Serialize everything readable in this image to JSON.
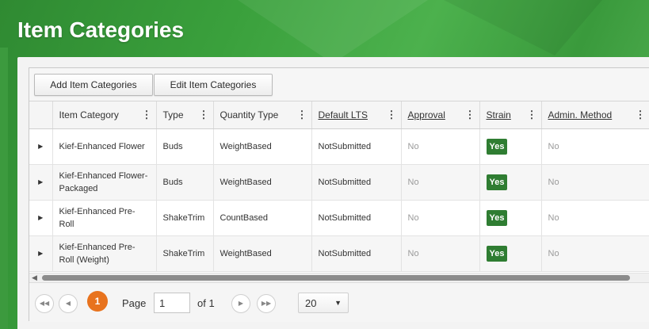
{
  "page": {
    "title": "Item Categories"
  },
  "toolbar": {
    "add_label": "Add Item Categories",
    "edit_label": "Edit Item Categories"
  },
  "grid": {
    "columns": [
      {
        "label": "Item Category",
        "underline": false
      },
      {
        "label": "Type",
        "underline": false
      },
      {
        "label": "Quantity Type",
        "underline": false
      },
      {
        "label": "Default LTS",
        "underline": true
      },
      {
        "label": "Approval",
        "underline": true
      },
      {
        "label": "Strain",
        "underline": true
      },
      {
        "label": "Admin. Method",
        "underline": true
      }
    ],
    "rows": [
      {
        "item_category": "Kief-Enhanced Flower",
        "type": "Buds",
        "quantity_type": "WeightBased",
        "default_lts": "NotSubmitted",
        "approval": "No",
        "strain": "Yes",
        "admin_method": "No"
      },
      {
        "item_category": "Kief-Enhanced Flower-Packaged",
        "type": "Buds",
        "quantity_type": "WeightBased",
        "default_lts": "NotSubmitted",
        "approval": "No",
        "strain": "Yes",
        "admin_method": "No"
      },
      {
        "item_category": "Kief-Enhanced Pre-Roll",
        "type": "ShakeTrim",
        "quantity_type": "CountBased",
        "default_lts": "NotSubmitted",
        "approval": "No",
        "strain": "Yes",
        "admin_method": "No"
      },
      {
        "item_category": "Kief-Enhanced Pre-Roll (Weight)",
        "type": "ShakeTrim",
        "quantity_type": "WeightBased",
        "default_lts": "NotSubmitted",
        "approval": "No",
        "strain": "Yes",
        "admin_method": "No"
      }
    ]
  },
  "pager": {
    "current_page": "1",
    "page_label": "Page",
    "page_input": "1",
    "of_label": "of 1",
    "page_size": "20"
  },
  "icons": {
    "first": "first-page-icon",
    "prev": "prev-page-icon",
    "next": "next-page-icon",
    "last": "last-page-icon",
    "expand": "expand-row-icon",
    "column_menu": "column-menu-icon"
  },
  "colors": {
    "header_green": "#3aa03c",
    "yes_badge": "#2f7d32",
    "current_page": "#e8731e"
  }
}
